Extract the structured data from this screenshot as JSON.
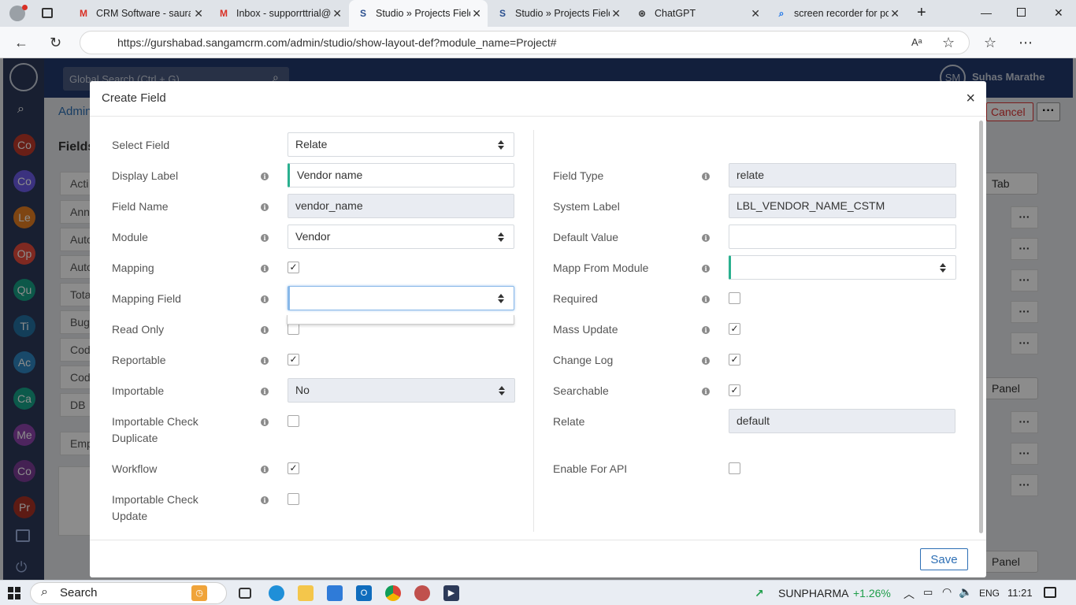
{
  "browser": {
    "tabs": [
      {
        "label": "CRM Software - saura",
        "icon": "M",
        "icon_color": "#d93025"
      },
      {
        "label": "Inbox - supporrttrial@",
        "icon": "M",
        "icon_color": "#d93025"
      },
      {
        "label": "Studio » Projects Field",
        "icon": "S",
        "icon_color": "#2a4f8f"
      },
      {
        "label": "Studio » Projects Field",
        "icon": "S",
        "icon_color": "#2a4f8f"
      },
      {
        "label": "ChatGPT",
        "icon": "⊛",
        "icon_color": "#222222"
      },
      {
        "label": "screen recorder for pc",
        "icon": "⌕",
        "icon_color": "#1a73e8"
      }
    ],
    "url": "https://gurshabad.sangamcrm.com/admin/studio/show-layout-def?module_name=Project#"
  },
  "app": {
    "global_search_placeholder": "Global Search (Ctrl + G)",
    "user_initials": "SM",
    "user_name": "Suhas Marathe",
    "breadcrumb": "Admin",
    "cancel_label": "Cancel",
    "page_heading": "Fields",
    "sidebar_items": [
      {
        "label": "Co",
        "color": "#c0392b"
      },
      {
        "label": "Co",
        "color": "#6c5ce7"
      },
      {
        "label": "Le",
        "color": "#e67e22"
      },
      {
        "label": "Op",
        "color": "#e74c3c"
      },
      {
        "label": "Qu",
        "color": "#16a085"
      },
      {
        "label": "Ti",
        "color": "#2471a3"
      },
      {
        "label": "Ac",
        "color": "#2e86c1"
      },
      {
        "label": "Ca",
        "color": "#17a589"
      },
      {
        "label": "Me",
        "color": "#8e44ad"
      },
      {
        "label": "Co",
        "color": "#7d3c98"
      },
      {
        "label": "Pr",
        "color": "#a93226"
      }
    ],
    "bg_rows": [
      "Acti",
      "Ann",
      "Auto",
      "Auto",
      "Tota",
      "Bug",
      "Cod",
      "Cod",
      "DB"
    ],
    "bg_emp": "Emp",
    "tab_select": "Tab",
    "panel_select_1": "Panel",
    "panel_select_2": "Panel"
  },
  "modal": {
    "title": "Create Field",
    "close_symbol": "×",
    "save_label": "Save",
    "left_fields": {
      "select_field": {
        "label": "Select Field",
        "value": "Relate"
      },
      "display_label": {
        "label": "Display Label",
        "value": "Vendor name"
      },
      "field_name": {
        "label": "Field Name",
        "value": "vendor_name"
      },
      "module": {
        "label": "Module",
        "value": "Vendor"
      },
      "mapping": {
        "label": "Mapping",
        "checked": true
      },
      "mapping_field": {
        "label": "Mapping Field",
        "value": ""
      },
      "read_only": {
        "label": "Read Only",
        "checked": false
      },
      "reportable": {
        "label": "Reportable",
        "checked": true
      },
      "importable": {
        "label": "Importable",
        "value": "No"
      },
      "importable_check_duplicate": {
        "label_line1": "Importable Check",
        "label_line2": "Duplicate",
        "checked": false
      },
      "workflow": {
        "label": "Workflow",
        "checked": true
      },
      "importable_check_update": {
        "label_line1": "Importable Check",
        "label_line2": "Update",
        "checked": false
      }
    },
    "right_fields": {
      "field_type": {
        "label": "Field Type",
        "value": "relate"
      },
      "system_label": {
        "label": "System Label",
        "value": "LBL_VENDOR_NAME_CSTM"
      },
      "default_value": {
        "label": "Default Value",
        "value": ""
      },
      "mapp_from_module": {
        "label": "Mapp From Module",
        "value": ""
      },
      "required": {
        "label": "Required",
        "checked": false
      },
      "mass_update": {
        "label": "Mass Update",
        "checked": true
      },
      "change_log": {
        "label": "Change Log",
        "checked": true
      },
      "searchable": {
        "label": "Searchable",
        "checked": true
      },
      "relate": {
        "label": "Relate",
        "value": "default"
      },
      "enable_for_api": {
        "label": "Enable For API",
        "checked": false
      }
    },
    "info_symbol": "i",
    "check_symbol": "✓"
  },
  "taskbar": {
    "search_label": "Search",
    "stock_name": "SUNPHARMA",
    "stock_change": "+1.26%",
    "language": "ENG",
    "time": "11:21"
  }
}
